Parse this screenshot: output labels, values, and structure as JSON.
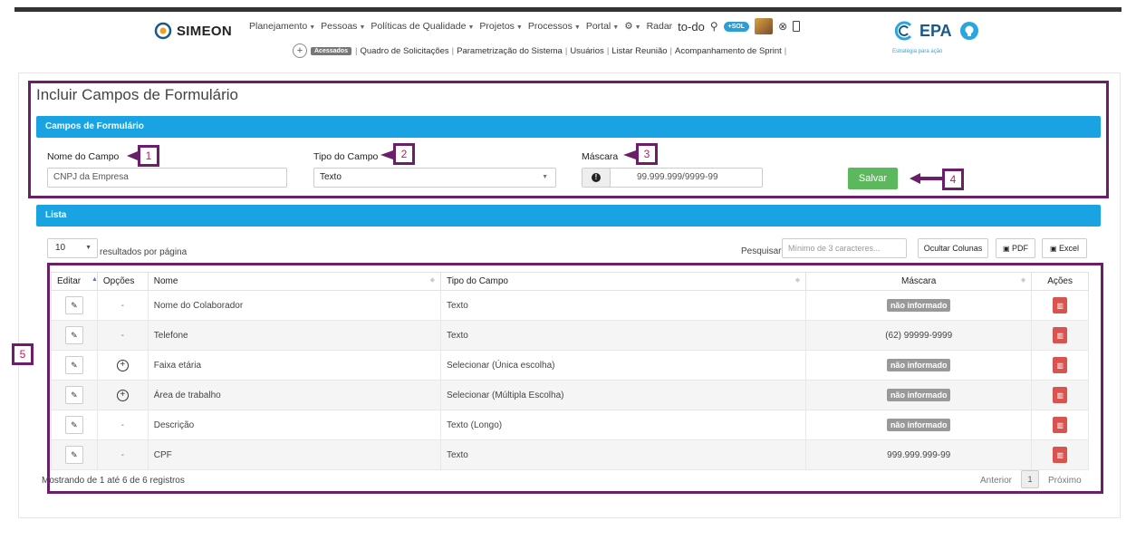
{
  "app": {
    "name": "SIMEON"
  },
  "nav": {
    "items": [
      {
        "label": "Planejamento",
        "caret": true
      },
      {
        "label": "Pessoas",
        "caret": true
      },
      {
        "label": "Políticas de Qualidade",
        "caret": true
      },
      {
        "label": "Projetos",
        "caret": true
      },
      {
        "label": "Processos",
        "caret": true
      },
      {
        "label": "Portal",
        "caret": true
      }
    ],
    "radar": "Radar",
    "todo": "to-do",
    "sol_badge": "+SOL"
  },
  "subnav": {
    "acessados": "Acessados",
    "links": [
      "Quadro de Solicitações",
      "Parametrização do Sistema",
      "Usuários",
      "Listar Reunião",
      "Acompanhamento de Sprint"
    ]
  },
  "brand": {
    "name": "EPA",
    "tagline": "Estratégia para ação"
  },
  "page": {
    "title": "Incluir Campos de Formulário"
  },
  "form": {
    "section_title": "Campos de Formulário",
    "nome_label": "Nome do Campo",
    "nome_value": "CNPJ da Empresa",
    "tipo_label": "Tipo do Campo",
    "tipo_value": "Texto",
    "mascara_label": "Máscara",
    "mascara_value": "99.999.999/9999-99",
    "save_label": "Salvar"
  },
  "list": {
    "section_title": "Lista",
    "page_size": "10",
    "per_page_text": "resultados por página",
    "search_label": "Pesquisar",
    "search_placeholder": "Mínimo de 3 caracteres...",
    "btn_hide": "Ocultar Colunas",
    "btn_pdf": "PDF",
    "btn_excel": "Excel",
    "columns": [
      "Editar",
      "Opções",
      "Nome",
      "Tipo do Campo",
      "Máscara",
      "Ações"
    ],
    "rows": [
      {
        "opcoes": "-",
        "nome": "Nome do Colaborador",
        "tipo": "Texto",
        "mascara": "não informado",
        "mask_badge": true
      },
      {
        "opcoes": "-",
        "nome": "Telefone",
        "tipo": "Texto",
        "mascara": "(62) 99999-9999",
        "mask_badge": false
      },
      {
        "opcoes": "+",
        "nome": "Faixa etária",
        "tipo": "Selecionar (Única escolha)",
        "mascara": "não informado",
        "mask_badge": true
      },
      {
        "opcoes": "+",
        "nome": "Área de trabalho",
        "tipo": "Selecionar (Múltipla Escolha)",
        "mascara": "não informado",
        "mask_badge": true
      },
      {
        "opcoes": "-",
        "nome": "Descrição",
        "tipo": "Texto (Longo)",
        "mascara": "não informado",
        "mask_badge": true
      },
      {
        "opcoes": "-",
        "nome": "CPF",
        "tipo": "Texto",
        "mascara": "999.999.999-99",
        "mask_badge": false
      }
    ],
    "footer_info": "Mostrando de 1 até 6 de 6 registros",
    "prev": "Anterior",
    "page": "1",
    "next": "Próximo"
  },
  "callouts": [
    "1",
    "2",
    "3",
    "4",
    "5"
  ],
  "colors": {
    "accent": "#1aa3e2",
    "annotation": "#6b1f6b",
    "save": "#5cb85c",
    "delete": "#d9534f"
  }
}
